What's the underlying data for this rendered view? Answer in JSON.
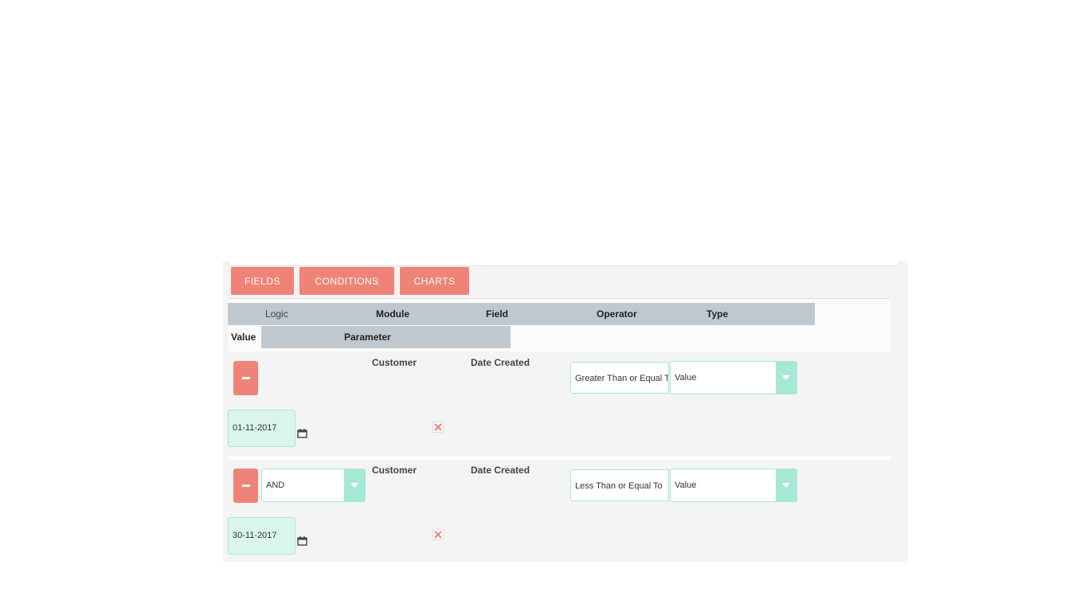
{
  "tabs": {
    "fields": "FIELDS",
    "conditions": "CONDITIONS",
    "charts": "CHARTS"
  },
  "headers": {
    "logic": "Logic",
    "module": "Module",
    "field": "Field",
    "operator": "Operator",
    "type": "Type",
    "value": "Value",
    "parameter": "Parameter"
  },
  "conditions": [
    {
      "logic": "",
      "module": "Customer",
      "field": "Date Created",
      "operator": "Greater Than or Equal To",
      "type": "Value",
      "value": "01-11-2017"
    },
    {
      "logic": "AND",
      "module": "Customer",
      "field": "Date Created",
      "operator": "Less Than or Equal To",
      "type": "Value",
      "value": "30-11-2017"
    }
  ],
  "colors": {
    "accent": "#f08377",
    "teal": "#a5e8d6",
    "header_bg": "#c0c8cf",
    "panel_bg": "#f4f4f4"
  }
}
